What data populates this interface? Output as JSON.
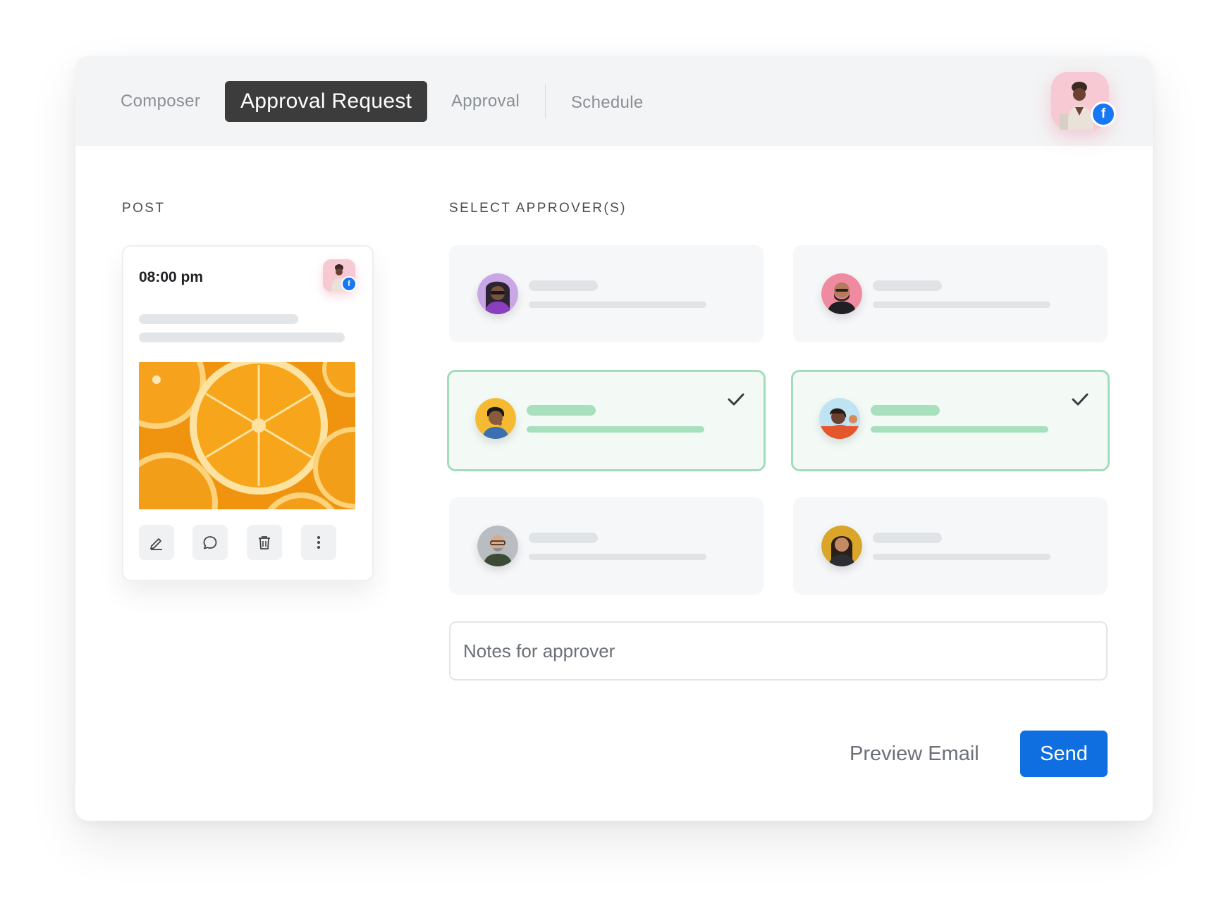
{
  "tabs": [
    {
      "label": "Composer"
    },
    {
      "label": "Approval Request",
      "active": true
    },
    {
      "label": "Approval"
    },
    {
      "label": "Schedule"
    }
  ],
  "profile": {
    "network_icon": "facebook-icon",
    "badge_glyph": "f"
  },
  "post": {
    "section_label": "POST",
    "time": "08:00 pm",
    "network_icon": "facebook-icon",
    "image": "orange-slices-image",
    "actions": [
      "edit-icon",
      "comment-icon",
      "trash-icon",
      "more-vertical-icon"
    ]
  },
  "approvers": {
    "section_label": "SELECT APPROVER(S)",
    "items": [
      {
        "selected": false,
        "avatar_color": "#a585d6"
      },
      {
        "selected": false,
        "avatar_color": "#ef7a8c"
      },
      {
        "selected": true,
        "avatar_color": "#f5b932"
      },
      {
        "selected": true,
        "avatar_color": "#e8552f"
      },
      {
        "selected": false,
        "avatar_color": "#9aa0a6"
      },
      {
        "selected": false,
        "avatar_color": "#d9a62a"
      }
    ]
  },
  "notes": {
    "placeholder": "Notes for approver"
  },
  "footer": {
    "preview_label": "Preview Email",
    "send_label": "Send"
  },
  "colors": {
    "accent": "#0f6fe0",
    "active_tab": "#3c3c3c",
    "selected_border": "#a3dcba",
    "facebook": "#1877f2"
  }
}
